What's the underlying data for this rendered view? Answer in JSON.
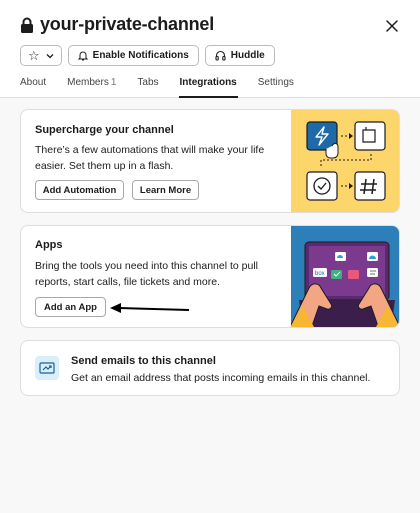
{
  "header": {
    "channel_name": "your-private-channel",
    "close_label": "✕",
    "star_glyph": "☆",
    "enable_notifications": "Enable Notifications",
    "huddle": "Huddle"
  },
  "tabs": [
    {
      "label": "About"
    },
    {
      "label": "Members",
      "count": "1"
    },
    {
      "label": "Tabs"
    },
    {
      "label": "Integrations",
      "active": true
    },
    {
      "label": "Settings"
    }
  ],
  "automation_card": {
    "title": "Supercharge your channel",
    "description": "There’s a few automations that will make your life easier. Set them up in a flash.",
    "add_automation": "Add Automation",
    "learn_more": "Learn More",
    "illustration_bg": "#fcd56b"
  },
  "apps_card": {
    "title": "Apps",
    "description": "Bring the tools you need into this channel to pull reports, start calls, file tickets and more.",
    "add_app": "Add an App",
    "illustration_bg": "#2c7fb8",
    "app_badge": "box"
  },
  "email_card": {
    "title": "Send emails to this channel",
    "description": "Get an email address that posts incoming emails in this channel."
  },
  "icons": {
    "lock": "lock-icon",
    "close": "close-icon",
    "star": "star-icon",
    "chevron": "chevron-down-icon",
    "bell": "bell-icon",
    "headphones": "headphones-icon",
    "email": "email-forward-icon"
  }
}
